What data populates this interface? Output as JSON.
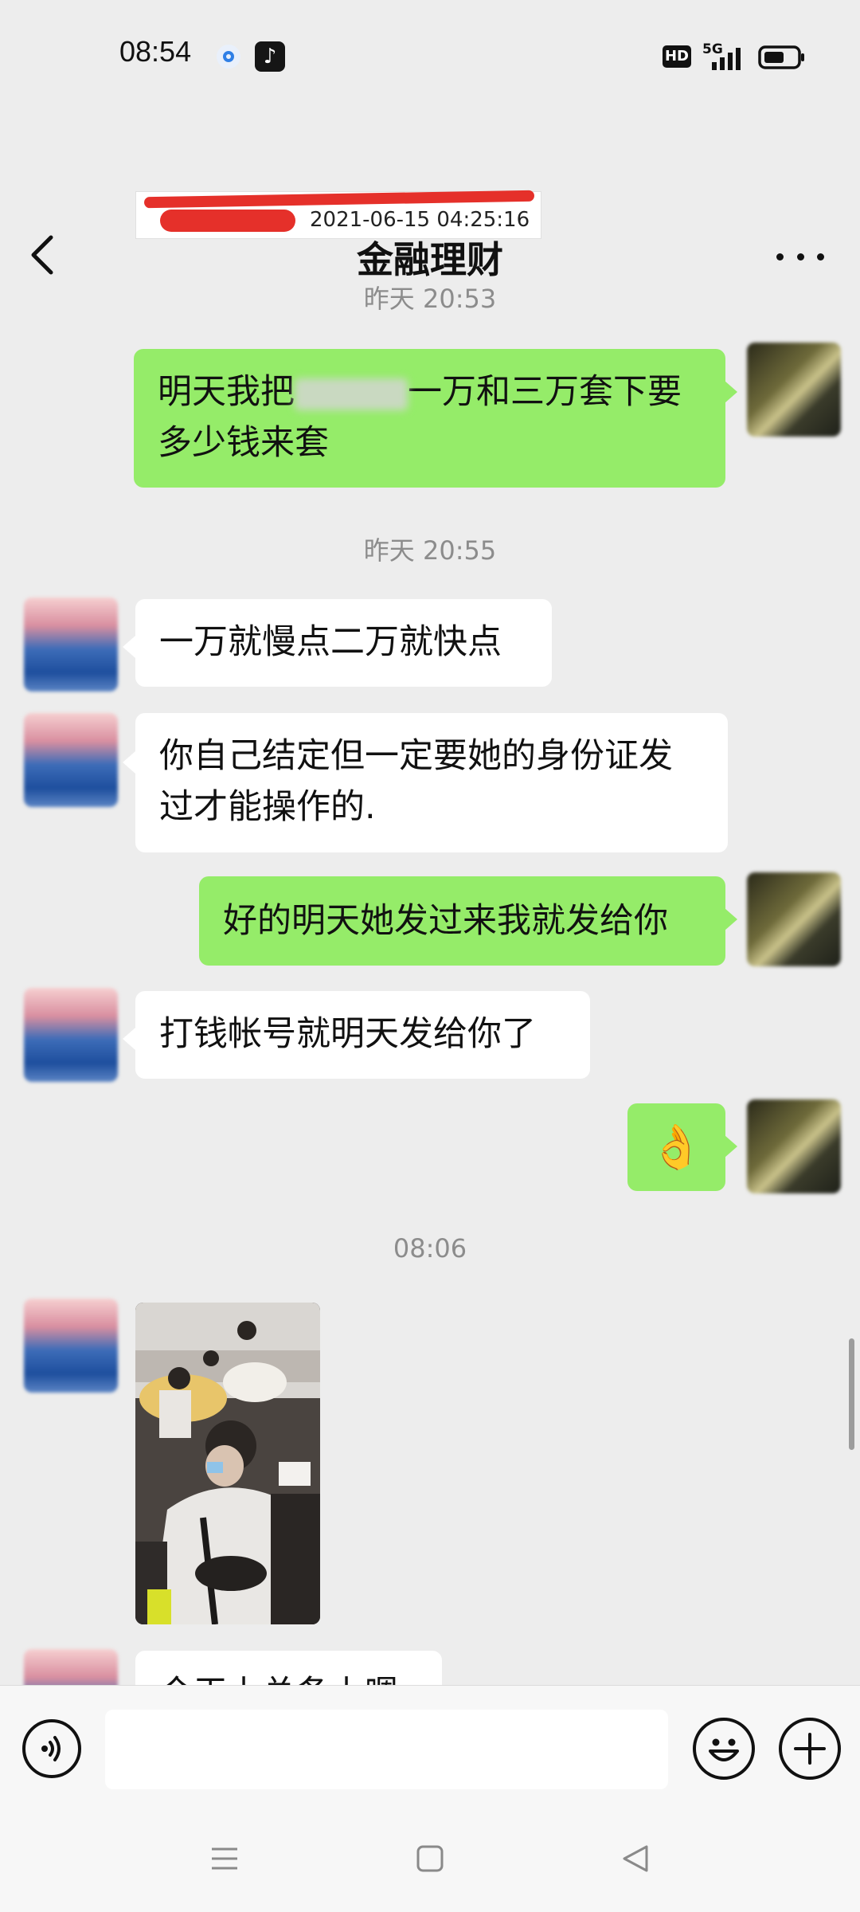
{
  "status_bar": {
    "time": "08:54",
    "hd_label": "HD",
    "network_label": "5G"
  },
  "header": {
    "title": "金融理财"
  },
  "chat": {
    "prev_card_time": "2021-06-15 04:25:16",
    "timestamps": [
      "昨天 20:53",
      "昨天 20:55",
      "08:06"
    ],
    "messages": [
      {
        "side": "me",
        "text_before": "明天我把",
        "text_after": "一万和三万套下要",
        "line2": "多少钱来套"
      },
      {
        "side": "other",
        "text": "一万就慢点二万就快点"
      },
      {
        "side": "other",
        "line1": "你自己结定但一定要她的身份证发",
        "line2": "过才能操作的."
      },
      {
        "side": "me",
        "text": "好的明天她发过来我就发给你"
      },
      {
        "side": "other",
        "text": "打钱帐号就明天发给你了"
      },
      {
        "side": "me",
        "emoji": "👌"
      },
      {
        "side": "other",
        "type": "image"
      },
      {
        "side": "other",
        "partial_text": "今天上总条上嗯"
      }
    ]
  },
  "colors": {
    "background": "#ededed",
    "my_bubble": "#95ec69",
    "other_bubble": "#ffffff",
    "timestamp_text": "#8c8c8c"
  }
}
